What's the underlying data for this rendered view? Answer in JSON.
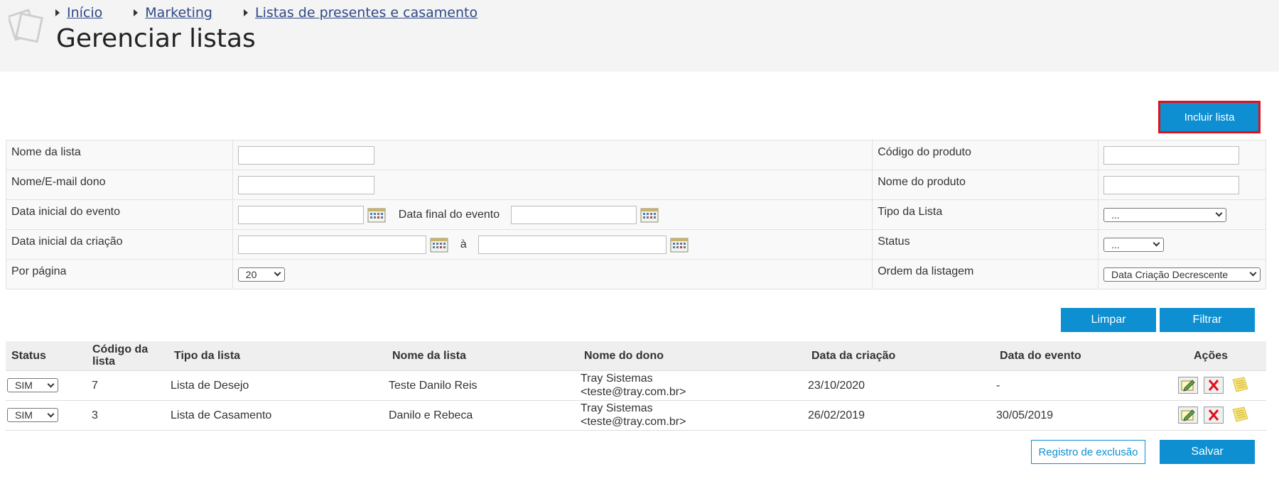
{
  "breadcrumb": [
    {
      "label": "Início"
    },
    {
      "label": "Marketing"
    },
    {
      "label": "Listas de presentes e casamento"
    }
  ],
  "page": {
    "title": "Gerenciar listas"
  },
  "include_button": "Incluir lista",
  "filter": {
    "list_name": {
      "label": "Nome da lista",
      "value": ""
    },
    "owner": {
      "label": "Nome/E-mail dono",
      "value": ""
    },
    "event_start": {
      "label": "Data inicial do evento",
      "value": ""
    },
    "event_end": {
      "label": "Data final do evento",
      "value": ""
    },
    "creation_start": {
      "label": "Data inicial da criação",
      "value": ""
    },
    "creation_sep": "à",
    "per_page": {
      "label": "Por página",
      "value": "20"
    },
    "product_code": {
      "label": "Código do produto",
      "value": ""
    },
    "product_name": {
      "label": "Nome do produto",
      "value": ""
    },
    "list_type": {
      "label": "Tipo da Lista",
      "value": "..."
    },
    "status": {
      "label": "Status",
      "value": "..."
    },
    "order": {
      "label": "Ordem da listagem",
      "value": "Data Criação Decrescente"
    }
  },
  "buttons": {
    "clear": "Limpar",
    "filter": "Filtrar",
    "deletion_log": "Registro de exclusão",
    "save": "Salvar"
  },
  "table": {
    "headers": [
      "Status",
      "Código da lista",
      "Tipo da lista",
      "Nome da lista",
      "Nome do dono",
      "Data da criação",
      "Data do evento",
      "Ações"
    ],
    "rows": [
      {
        "status": "SIM",
        "code": "7",
        "type": "Lista de Desejo",
        "name": "Teste Danilo Reis",
        "owner_name": "Tray Sistemas",
        "owner_email": "<teste@tray.com.br>",
        "created": "23/10/2020",
        "event": "-"
      },
      {
        "status": "SIM",
        "code": "3",
        "type": "Lista de Casamento",
        "name": "Danilo e Rebeca",
        "owner_name": "Tray Sistemas",
        "owner_email": "<teste@tray.com.br>",
        "created": "26/02/2019",
        "event": "30/05/2019"
      }
    ]
  },
  "colors": {
    "accent": "#0d8fd1",
    "highlight": "#e0111b",
    "header_bg": "#f4f4f4"
  },
  "icons": {
    "edit": "edit-icon",
    "delete": "delete-icon",
    "notes": "notes-icon",
    "calendar": "calendar-icon"
  }
}
